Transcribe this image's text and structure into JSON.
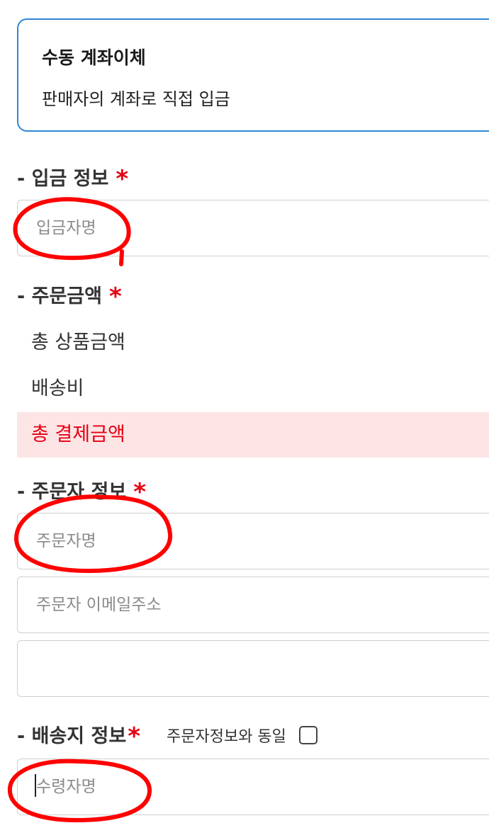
{
  "payment_method": {
    "title": "수동 계좌이체",
    "description": "판매자의 계좌로 직접 입금"
  },
  "deposit_info": {
    "title": "- 입금 정보",
    "required_mark": "*",
    "depositor_placeholder": "입금자명"
  },
  "order_amount": {
    "title": "- 주문금액",
    "required_mark": "*",
    "rows": [
      {
        "label": "총 상품금액"
      },
      {
        "label": "배송비"
      },
      {
        "label": "총 결제금액"
      }
    ]
  },
  "orderer_info": {
    "title": "- 주문자 정보",
    "required_mark": "*",
    "name_placeholder": "주문자명",
    "email_placeholder": "주문자 이메일주소",
    "third_field_value": ""
  },
  "shipping_info": {
    "title": "- 배송지 정보",
    "required_mark": "*",
    "same_as_orderer_label": "주문자정보와 동일",
    "same_as_orderer_checked": false,
    "recipient_placeholder": "수령자명"
  },
  "colors": {
    "accent_blue": "#2f86d6",
    "required_red": "#e60012",
    "total_highlight": "#fde5e5",
    "annotation_red": "#ff0000"
  }
}
